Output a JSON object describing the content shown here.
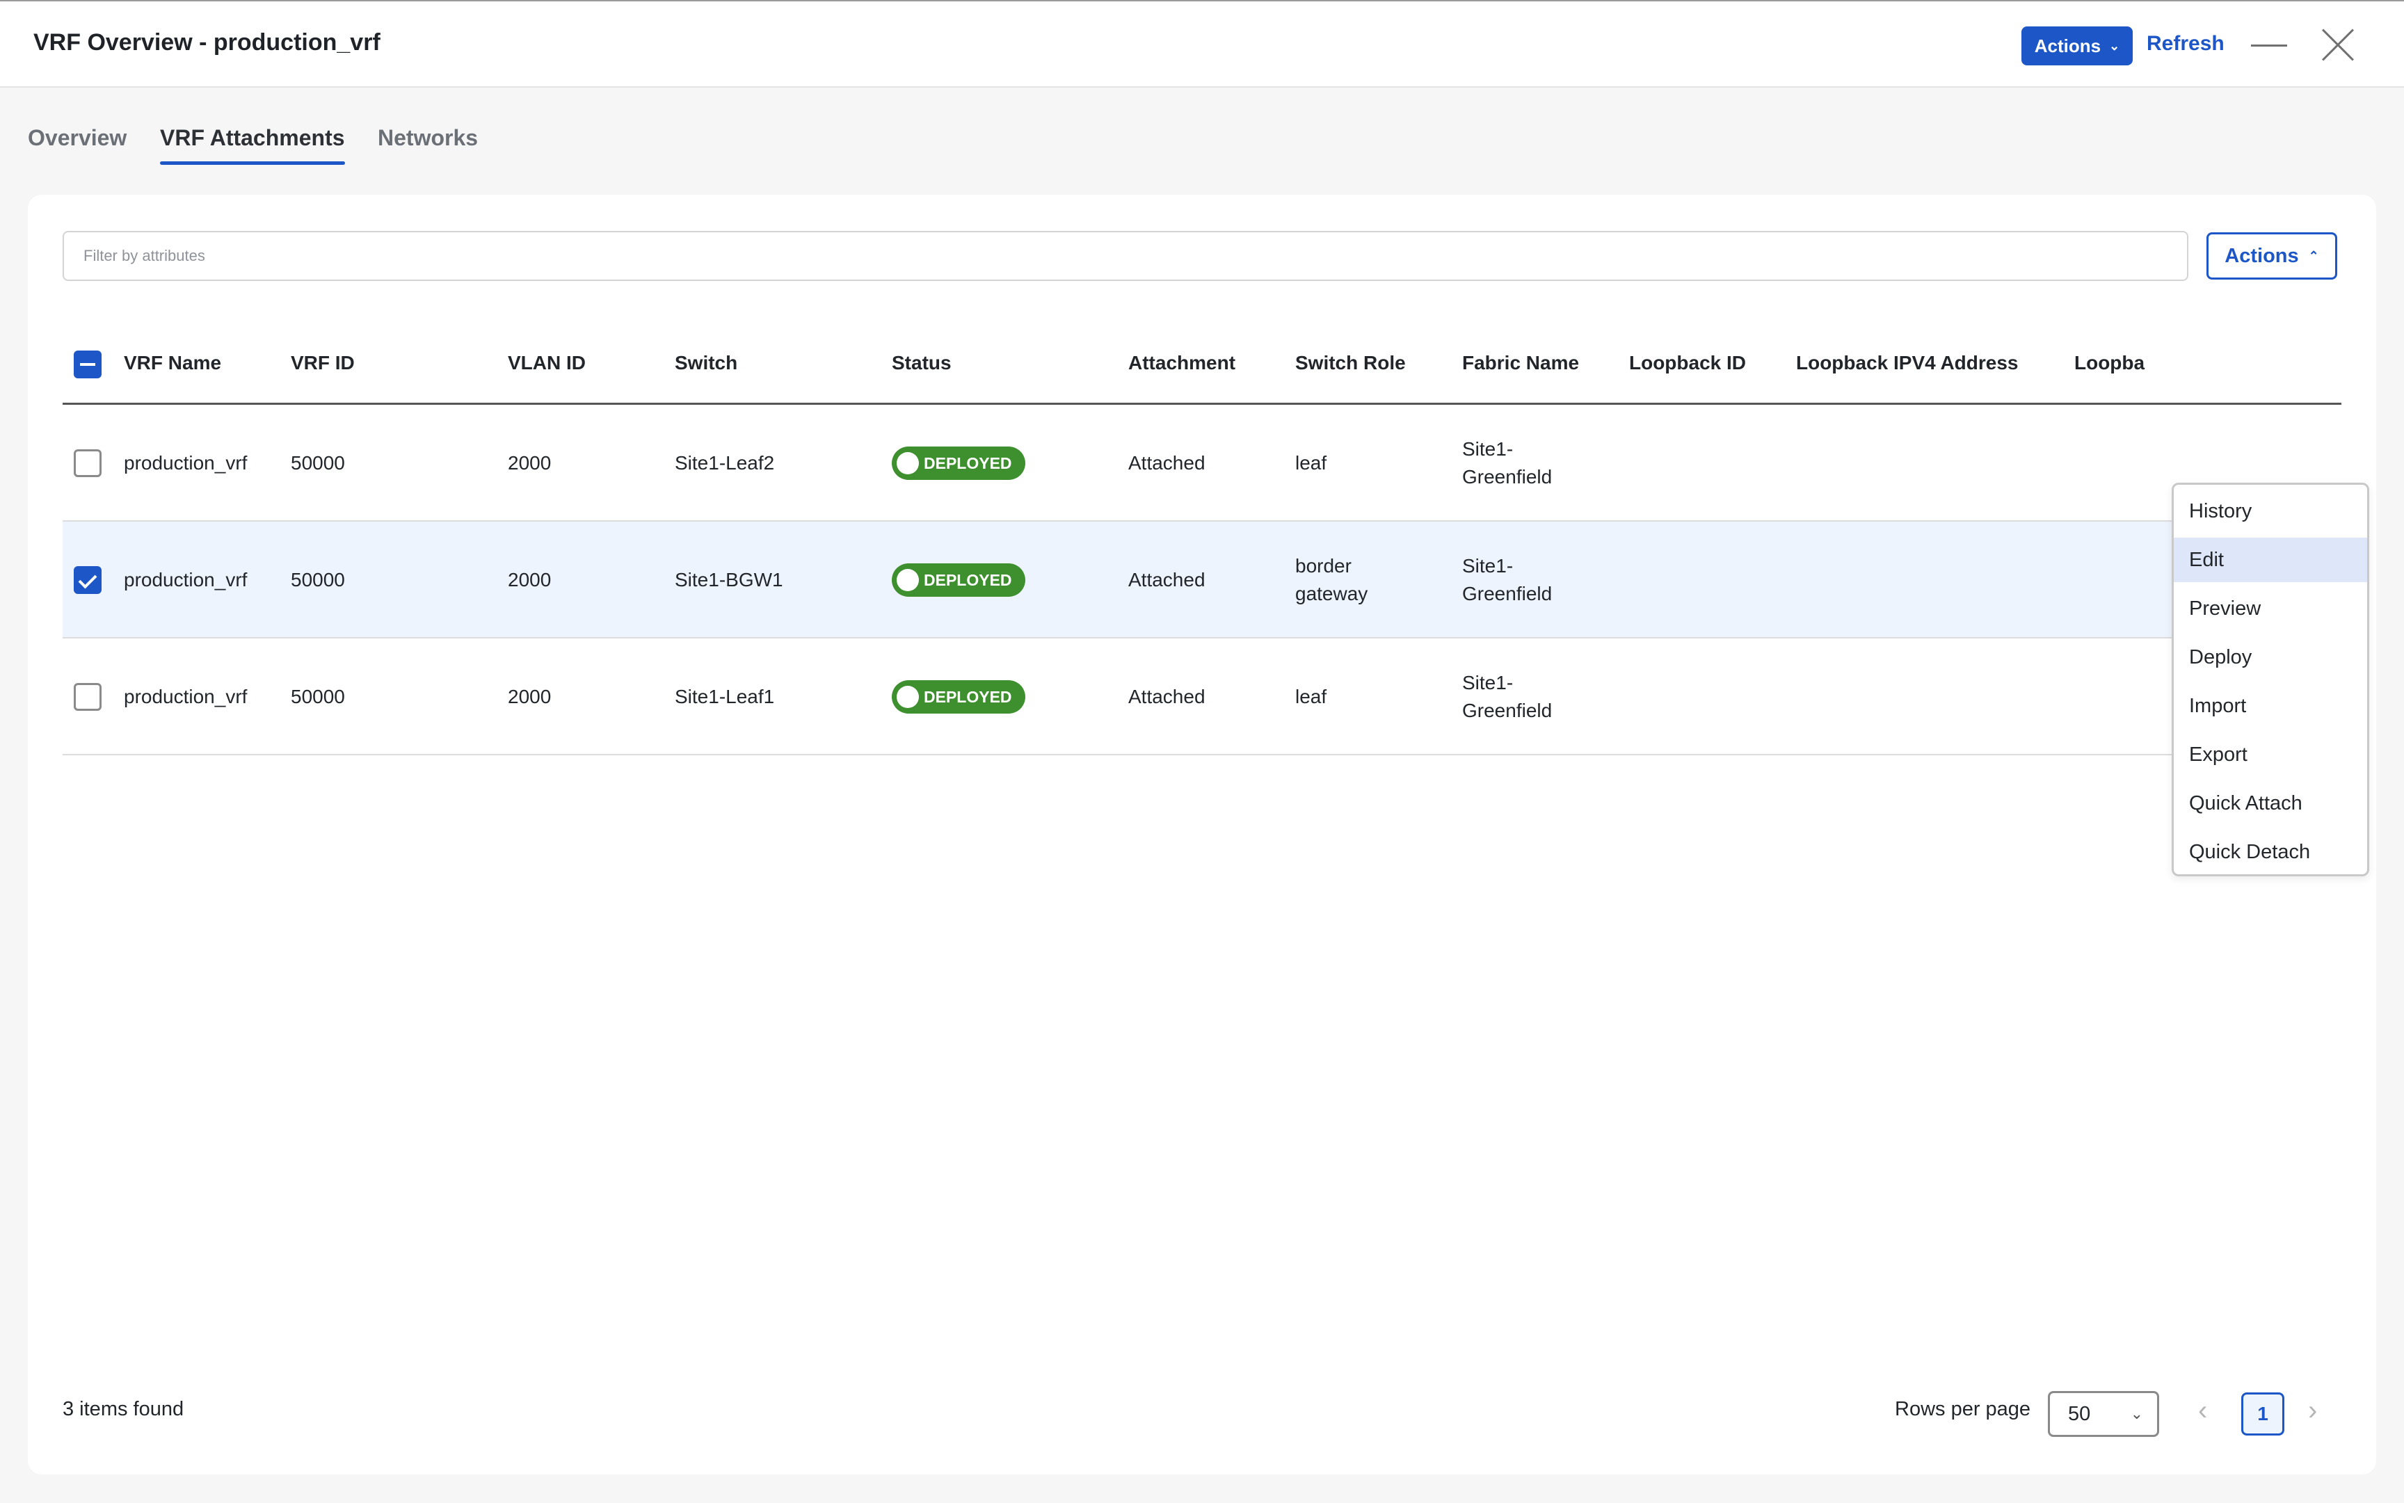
{
  "window": {
    "title": "VRF Overview - production_vrf",
    "actions_label": "Actions",
    "refresh_label": "Refresh"
  },
  "tabs": [
    {
      "label": "Overview",
      "active": false
    },
    {
      "label": "VRF Attachments",
      "active": true
    },
    {
      "label": "Networks",
      "active": false
    }
  ],
  "toolbar": {
    "filter_placeholder": "Filter by attributes",
    "filter_value": "",
    "actions_label": "Actions"
  },
  "table": {
    "columns": [
      "VRF Name",
      "VRF ID",
      "VLAN ID",
      "Switch",
      "Status",
      "Attachment",
      "Switch Role",
      "Fabric Name",
      "Loopback ID",
      "Loopback IPV4 Address",
      "Loopba"
    ],
    "rows": [
      {
        "selected": false,
        "vrf_name": "production_vrf",
        "vrf_id": "50000",
        "vlan_id": "2000",
        "switch": "Site1-Leaf2",
        "status": "DEPLOYED",
        "attachment": "Attached",
        "switch_role": "leaf",
        "fabric_name": "Site1-Greenfield"
      },
      {
        "selected": true,
        "vrf_name": "production_vrf",
        "vrf_id": "50000",
        "vlan_id": "2000",
        "switch": "Site1-BGW1",
        "status": "DEPLOYED",
        "attachment": "Attached",
        "switch_role": "border gateway",
        "fabric_name": "Site1-Greenfield"
      },
      {
        "selected": false,
        "vrf_name": "production_vrf",
        "vrf_id": "50000",
        "vlan_id": "2000",
        "switch": "Site1-Leaf1",
        "status": "DEPLOYED",
        "attachment": "Attached",
        "switch_role": "leaf",
        "fabric_name": "Site1-Greenfield"
      }
    ]
  },
  "actions_menu": {
    "items": [
      "History",
      "Edit",
      "Preview",
      "Deploy",
      "Import",
      "Export",
      "Quick Attach",
      "Quick Detach"
    ],
    "highlighted": "Edit"
  },
  "footer": {
    "items_found": "3 items found",
    "rows_per_page_label": "Rows per page",
    "rows_per_page_value": "50",
    "current_page": "1"
  },
  "colors": {
    "accent": "#1d57c7",
    "deployed": "#3e8f2e",
    "selected_row": "#eef4fd"
  }
}
